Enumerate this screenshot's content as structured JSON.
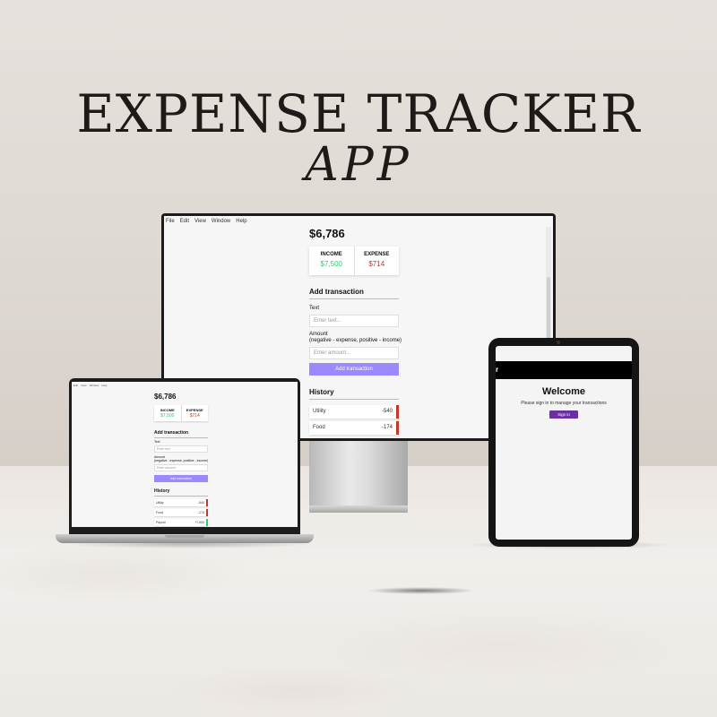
{
  "poster": {
    "title": "EXPENSE TRACKER",
    "subtitle": "APP"
  },
  "desktop_app": {
    "menu": [
      "File",
      "Edit",
      "View",
      "Window",
      "Help"
    ],
    "balance": "$6,786",
    "income_label": "INCOME",
    "income_value": "$7,500",
    "expense_label": "EXPENSE",
    "expense_value": "$714",
    "add_heading": "Add transaction",
    "text_label": "Text",
    "text_placeholder": "Enter text...",
    "amount_label": "Amount",
    "amount_hint": "(negative - expense, positive - income)",
    "amount_placeholder": "Enter amount...",
    "add_button": "Add transaction",
    "history_heading": "History",
    "history": [
      {
        "name": "Utility",
        "amount": "-540"
      },
      {
        "name": "Food",
        "amount": "-174"
      }
    ]
  },
  "laptop_app": {
    "menu": [
      "Edit",
      "View",
      "Window",
      "Help"
    ],
    "balance": "$6,786",
    "income_label": "INCOME",
    "income_value": "$7,500",
    "expense_label": "EXPENSE",
    "expense_value": "$714",
    "add_heading": "Add transaction",
    "text_label": "Text",
    "text_placeholder": "Enter text",
    "amount_label": "Amount",
    "amount_hint": "(negative - expense, positive - income)",
    "amount_placeholder": "Enter amount",
    "add_button": "Add transaction",
    "history_heading": "History",
    "history": [
      {
        "name": "Utility",
        "amount": "-540"
      },
      {
        "name": "Food",
        "amount": "-174"
      },
      {
        "name": "Payroll",
        "amount": "+7,500"
      }
    ]
  },
  "tablet_app": {
    "header_title": "r",
    "welcome": "Welcome",
    "sign_in_prompt": "Please sign in to manage your transactions",
    "sign_in_button": "Sign in"
  },
  "colors": {
    "income": "#2ecc71",
    "expense": "#c0392b",
    "primary_button": "#9c88ff",
    "sign_in_button": "#6a2fa0"
  }
}
